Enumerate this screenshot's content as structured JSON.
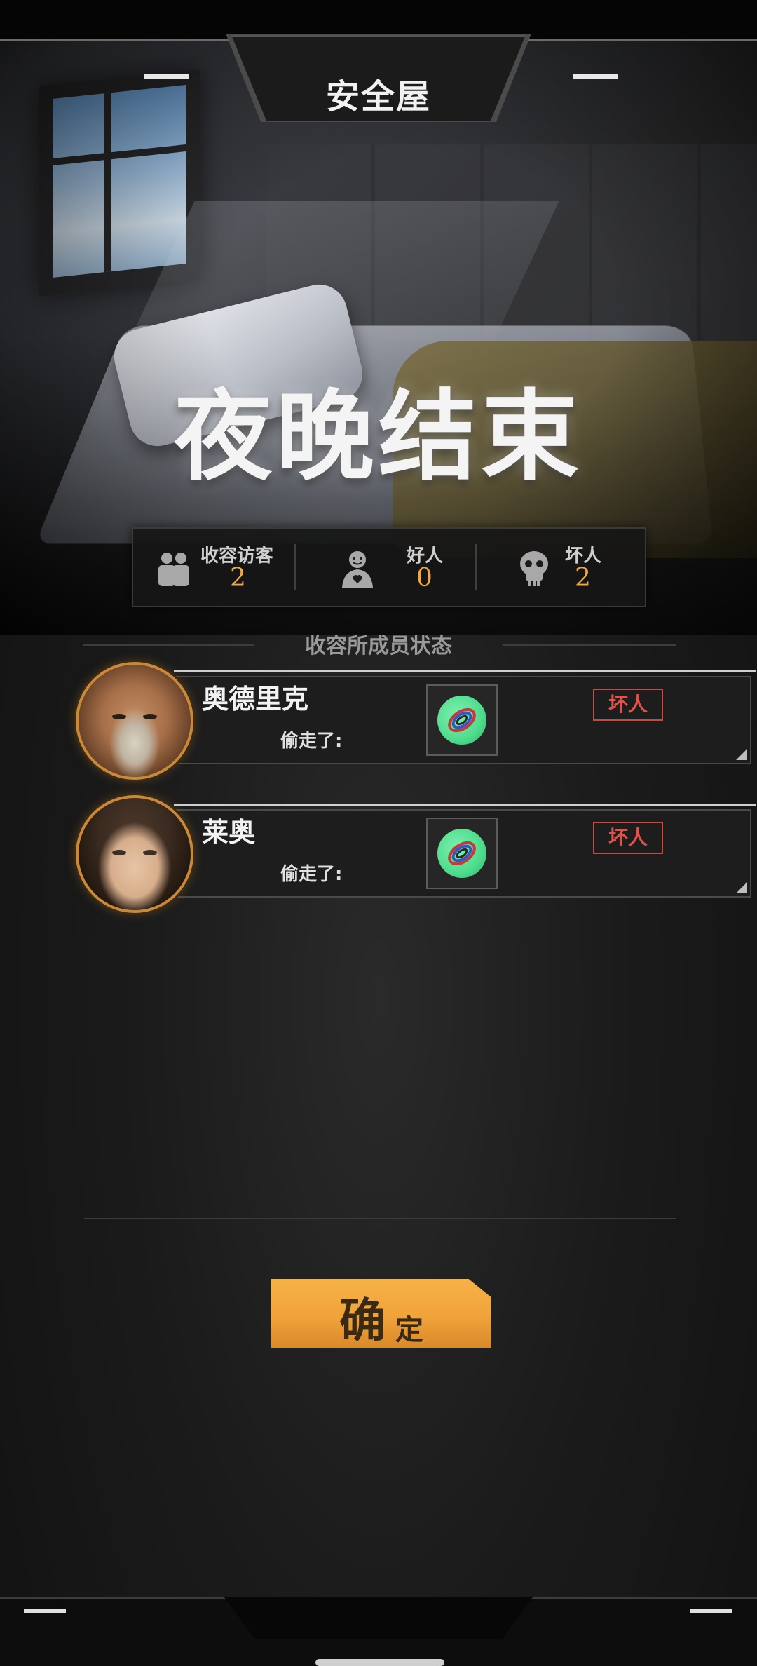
{
  "header": {
    "title": "安全屋"
  },
  "banner": {
    "text": "夜晚结束"
  },
  "stats": [
    {
      "label": "收容访客",
      "value": "2",
      "icon": "two-people-icon"
    },
    {
      "label": "好人",
      "value": "0",
      "icon": "smiling-person-icon"
    },
    {
      "label": "坏人",
      "value": "2",
      "icon": "skull-icon"
    }
  ],
  "section": {
    "title": "收容所成员状态"
  },
  "members": [
    {
      "name": "奥德里克",
      "action": "偷走了:",
      "item_icon": "rope-coil-icon",
      "status": "坏人",
      "avatar": "old-man-portrait"
    },
    {
      "name": "莱奥",
      "action": "偷走了:",
      "item_icon": "rope-coil-icon",
      "status": "坏人",
      "avatar": "young-man-portrait"
    }
  ],
  "confirm": {
    "main": "确",
    "sub": "定"
  },
  "colors": {
    "accent": "#f0a33a",
    "bad": "#e0534b",
    "value": "#f0a940",
    "item_bg": "#4fdc8c"
  }
}
